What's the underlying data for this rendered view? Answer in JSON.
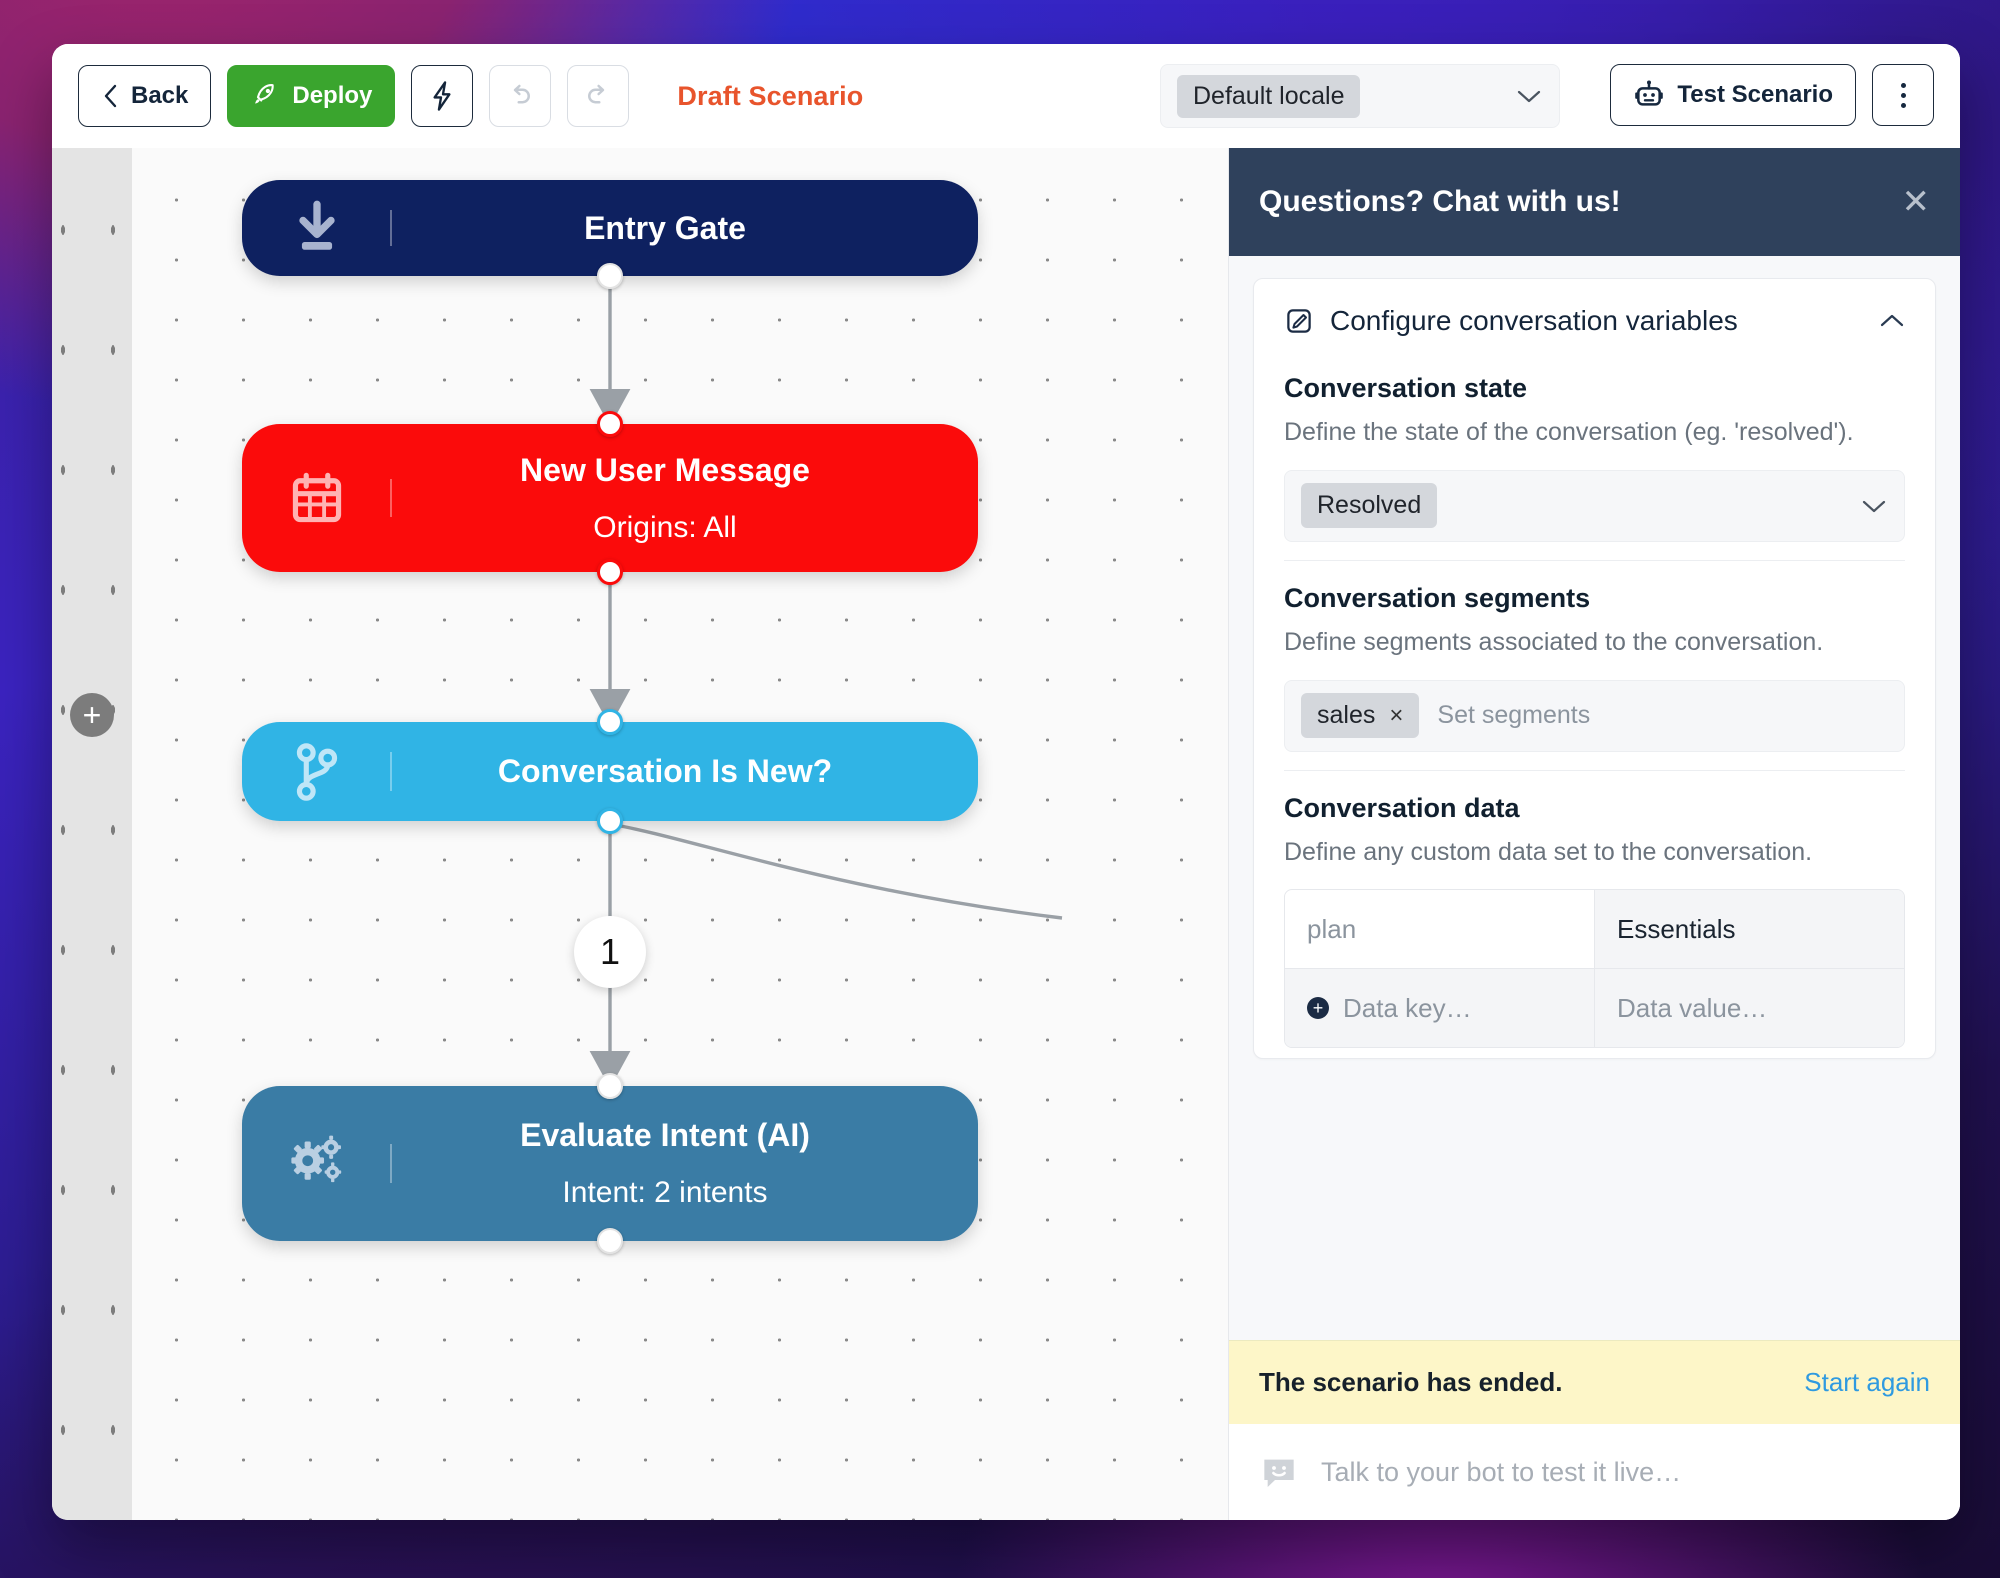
{
  "toolbar": {
    "back_label": "Back",
    "deploy_label": "Deploy",
    "lightning_label": "",
    "undo_label": "",
    "redo_label": "",
    "draft_title": "Draft Scenario",
    "locale_value": "Default locale",
    "test_scenario_label": "Test Scenario",
    "more_label": ""
  },
  "canvas": {
    "add_button_label": "+",
    "edge_badge": "1",
    "nodes": [
      {
        "title": "Entry Gate",
        "subtitle": "",
        "icon": "download-icon",
        "color": "#0e2160"
      },
      {
        "title": "New User Message",
        "subtitle": "Origins: All",
        "icon": "calendar-icon",
        "color": "#fb0b0b"
      },
      {
        "title": "Conversation Is New?",
        "subtitle": "",
        "icon": "git-branch-icon",
        "color": "#30b4e5"
      },
      {
        "title": "Evaluate Intent (AI)",
        "subtitle": "Intent: 2 intents",
        "icon": "gears-icon",
        "color": "#3a7ca5"
      }
    ]
  },
  "panel": {
    "header_title": "Questions? Chat with us!",
    "close_label": "✕",
    "card_title": "Configure conversation variables",
    "sections": [
      {
        "heading": "Conversation state",
        "description": "Define the state of the conversation (eg. 'resolved').",
        "value": "Resolved"
      },
      {
        "heading": "Conversation segments",
        "description": "Define segments associated to the conversation.",
        "tag": "sales",
        "tag_remove": "×",
        "placeholder": "Set segments"
      },
      {
        "heading": "Conversation data",
        "description": "Define any custom data set to the conversation."
      }
    ],
    "data_table": {
      "rows": [
        {
          "key": "plan",
          "value": "Essentials"
        },
        {
          "key": "Data key…",
          "value": "Data value…"
        }
      ],
      "add_icon": "+"
    },
    "ended_message": "The scenario has ended.",
    "start_again_label": "Start again",
    "composer_placeholder": "Talk to your bot to test it live…"
  }
}
